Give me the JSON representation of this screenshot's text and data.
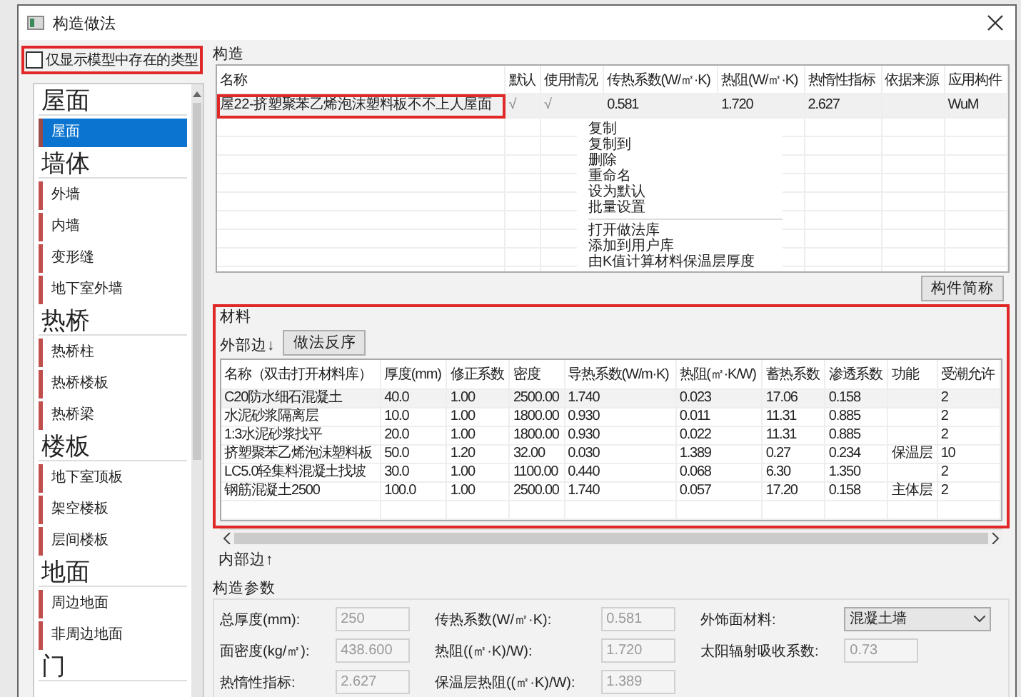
{
  "window": {
    "title": "构造做法"
  },
  "filter": {
    "label": "仅显示模型中存在的类型",
    "checked": false,
    "highlighted": true
  },
  "sidebar": {
    "groups": [
      {
        "title": "屋面",
        "items": [
          {
            "label": "屋面",
            "selected": true
          }
        ]
      },
      {
        "title": "墙体",
        "items": [
          {
            "label": "外墙",
            "selected": false
          },
          {
            "label": "内墙",
            "selected": false
          },
          {
            "label": "变形缝",
            "selected": false
          },
          {
            "label": "地下室外墙",
            "selected": false
          }
        ]
      },
      {
        "title": "热桥",
        "items": [
          {
            "label": "热桥柱",
            "selected": false
          },
          {
            "label": "热桥楼板",
            "selected": false
          },
          {
            "label": "热桥梁",
            "selected": false
          }
        ]
      },
      {
        "title": "楼板",
        "items": [
          {
            "label": "地下室顶板",
            "selected": false
          },
          {
            "label": "架空楼板",
            "selected": false
          },
          {
            "label": "层间楼板",
            "selected": false
          }
        ]
      },
      {
        "title": "地面",
        "items": [
          {
            "label": "周边地面",
            "selected": false
          },
          {
            "label": "非周边地面",
            "selected": false
          }
        ]
      },
      {
        "title": "门"
      }
    ]
  },
  "construction": {
    "title": "构造",
    "columns": [
      "名称",
      "默认",
      "使用情况",
      "传热系数(W/㎡·K)",
      "热阻(W/㎡·K)",
      "热惰性指标",
      "依据来源",
      "应用构件"
    ],
    "rows": [
      {
        "cells": [
          "屋22-挤塑聚苯乙烯泡沫塑料板不不上人屋面",
          "√",
          "√",
          "0.581",
          "1.720",
          "2.627",
          null,
          "WuM"
        ],
        "highlighted": true
      }
    ],
    "context_menu": [
      {
        "kind": "item",
        "label": "复制"
      },
      {
        "kind": "item",
        "label": "复制到"
      },
      {
        "kind": "item",
        "label": "删除"
      },
      {
        "kind": "item",
        "label": "重命名"
      },
      {
        "kind": "item",
        "label": "设为默认"
      },
      {
        "kind": "item",
        "label": "批量设置"
      },
      {
        "kind": "separator"
      },
      {
        "kind": "item",
        "label": "打开做法库"
      },
      {
        "kind": "item",
        "label": "添加到用户库"
      },
      {
        "kind": "item",
        "label": "由K值计算材料保温层厚度"
      }
    ],
    "button": "构件简称"
  },
  "materials": {
    "title": "材料",
    "highlighted": true,
    "outer_label": "外部边↓",
    "reverse_button": "做法反序",
    "columns": [
      "名称（双击打开材料库）",
      "厚度(mm)",
      "修正系数",
      "密度",
      "导热系数(W/m·K)",
      "热阻(㎡·K/W)",
      "蓄热系数",
      "渗透系数",
      "功能",
      "受潮允许"
    ],
    "rows": [
      [
        "C20防水细石混凝土",
        "40.0",
        "1.00",
        "2500.00",
        "1.740",
        "0.023",
        "17.06",
        "0.158",
        null,
        "2"
      ],
      [
        "水泥砂浆隔离层",
        "10.0",
        "1.00",
        "1800.00",
        "0.930",
        "0.011",
        "11.31",
        "0.885",
        null,
        "2"
      ],
      [
        "1:3水泥砂浆找平",
        "20.0",
        "1.00",
        "1800.00",
        "0.930",
        "0.022",
        "11.31",
        "0.885",
        null,
        "2"
      ],
      [
        "挤塑聚苯乙烯泡沫塑料板",
        "50.0",
        "1.20",
        "32.00",
        "0.030",
        "1.389",
        "0.27",
        "0.234",
        "保温层",
        "10"
      ],
      [
        "LC5.0轻集料混凝土找坡",
        "30.0",
        "1.00",
        "1100.00",
        "0.440",
        "0.068",
        "6.30",
        "1.350",
        null,
        "2"
      ],
      [
        "钢筋混凝土2500",
        "100.0",
        "1.00",
        "2500.00",
        "1.740",
        "0.057",
        "17.20",
        "0.158",
        "主体层",
        "2"
      ]
    ],
    "inner_label": "内部边↑"
  },
  "params": {
    "title": "构造参数",
    "fields": [
      {
        "kind": "text",
        "label": "总厚度(mm):",
        "value": "250"
      },
      {
        "kind": "text",
        "label": "传热系数(W/㎡·K):",
        "value": "0.581"
      },
      {
        "kind": "select",
        "label": "外饰面材料:",
        "value": "混凝土墙"
      },
      {
        "kind": "text",
        "label": "面密度(kg/㎡):",
        "value": "438.600"
      },
      {
        "kind": "text",
        "label": "热阻((㎡·K)/W):",
        "value": "1.720"
      },
      {
        "kind": "text",
        "label": "太阳辐射吸收系数:",
        "value": "0.73"
      },
      {
        "kind": "text",
        "label": "热惰性指标:",
        "value": "2.627"
      },
      {
        "kind": "text",
        "label": "保温层热阻((㎡·K)/W):",
        "value": "1.389"
      }
    ]
  }
}
